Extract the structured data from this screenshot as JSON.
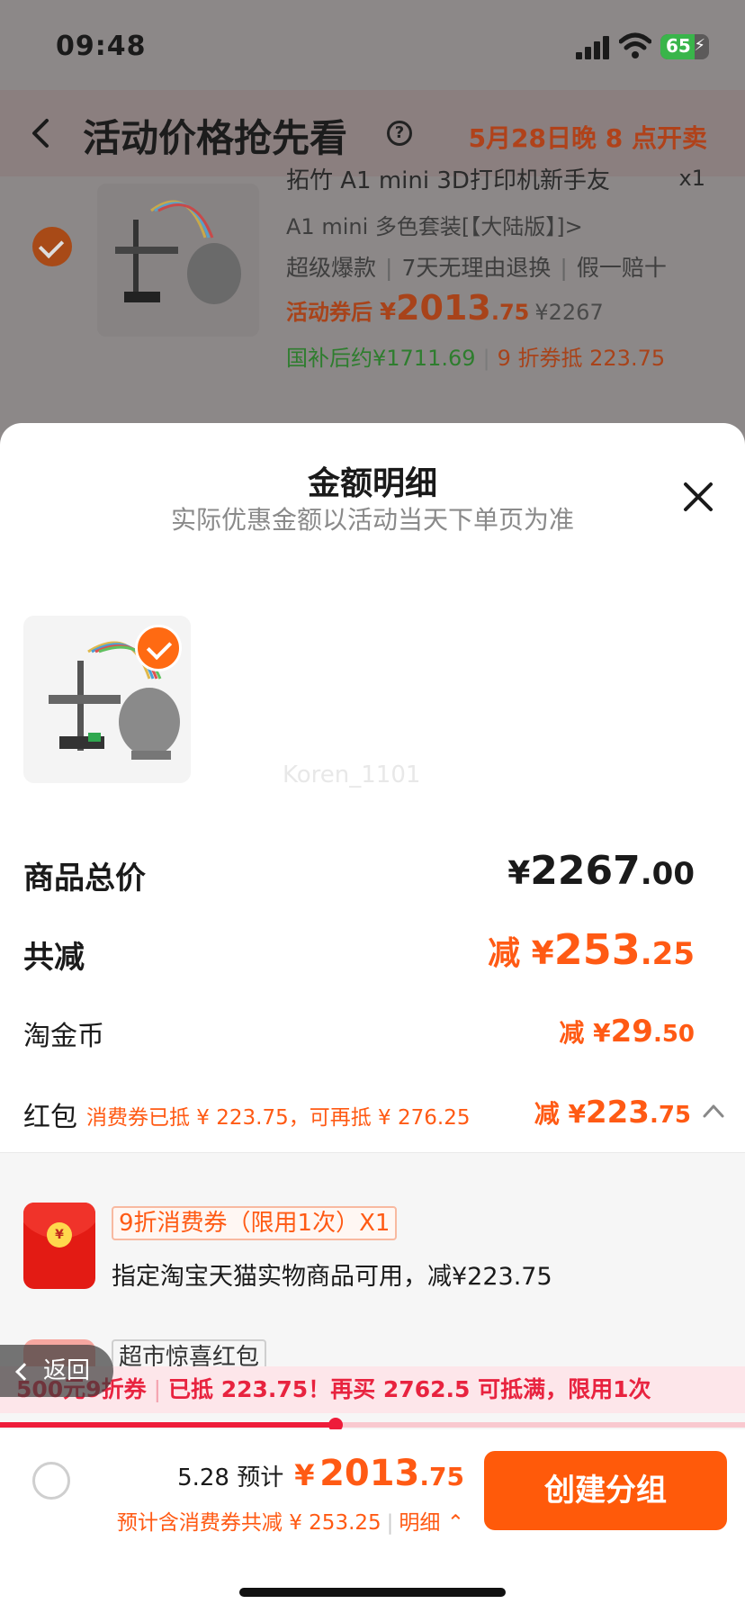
{
  "status_bar": {
    "time": "09:48",
    "battery": "65"
  },
  "nav": {
    "title": "活动价格抢先看",
    "help": "?",
    "sale_time": "5月28日晚 8 点开卖"
  },
  "background_product": {
    "name": "拓竹 A1 mini 3D打印机新手友",
    "qty": "x1",
    "sku": "A1 mini 多色套装[【大陆版】]>",
    "tags": [
      "超级爆款",
      "7天无理由退换",
      "假一赔十"
    ],
    "price_label": "活动券后",
    "price_yen": "¥",
    "price_int": "2013",
    "price_dec": ".75",
    "price_orig": "¥2267",
    "subsidy": "国补后约¥1711.69",
    "coupon": "9 折券抵 223.75"
  },
  "sheet": {
    "title": "金额明细",
    "subtitle": "实际优惠金额以活动当天下单页为准",
    "watermark": "Koren_1101",
    "total": {
      "label": "商品总价",
      "cur": "¥",
      "int": "2267",
      "dec": ".00"
    },
    "minus": {
      "label": "共减",
      "pre": "减 ¥",
      "int": "253",
      "dec": ".25"
    },
    "coins": {
      "label": "淘金币",
      "pre": "减 ¥",
      "int": "29",
      "dec": ".50"
    },
    "hongbao": {
      "label": "红包",
      "note": "消费券已抵 ¥ 223.75，可再抵 ¥ 276.25",
      "pre": "减 ¥",
      "int": "223",
      "dec": ".75"
    },
    "coupons": [
      {
        "tag": "9折消费券（限用1次）X1",
        "desc": "指定淘宝天猫实物商品可用，减¥223.75",
        "icon_symbol": "¥"
      },
      {
        "tag": "超市惊喜红包"
      }
    ]
  },
  "return_label": "返回",
  "promo": {
    "left": "500元9折券",
    "right": "已抵 223.75！再买 2762.5 可抵满，限用1次",
    "progress": 0.45
  },
  "footer": {
    "est_label": "5.28 预计",
    "yen": "¥",
    "int": "2013",
    "dec": ".75",
    "sub": "预计含消费券共减 ¥ 253.25",
    "detail": "明细",
    "create": "创建分组"
  },
  "colors": {
    "accent": "#ff5a14",
    "promo_red": "#ee1c3a",
    "subsidy_green": "#2e7d2e"
  },
  "icons": [
    "back-chevron-icon",
    "help-icon",
    "signal-icon",
    "wifi-icon",
    "battery-icon",
    "close-icon",
    "check-icon",
    "red-envelope-icon",
    "chevron-up-icon"
  ]
}
